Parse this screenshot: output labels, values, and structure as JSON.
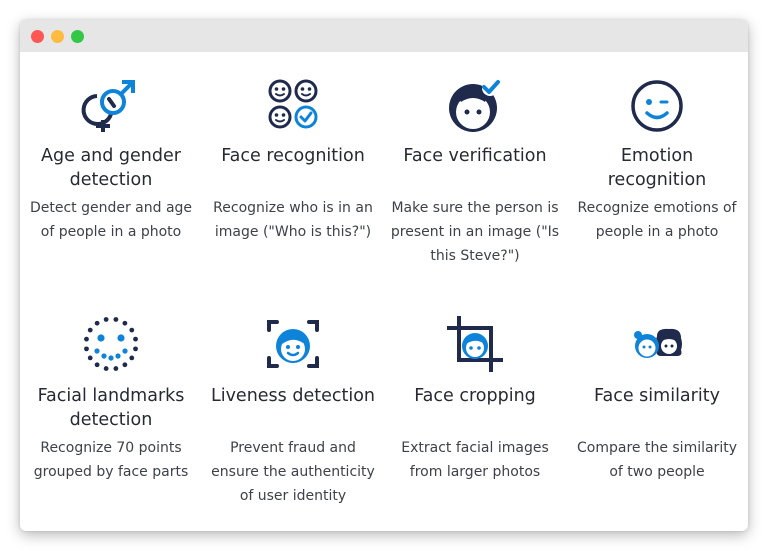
{
  "window": {
    "controls": [
      "close",
      "minimize",
      "maximize"
    ]
  },
  "colors": {
    "navy": "#1f2a4d",
    "blue": "#0d84d9"
  },
  "features": [
    {
      "icon": "gender-symbols-icon",
      "title": "Age and gender detection",
      "description": "Detect gender and age of people in a photo"
    },
    {
      "icon": "face-grid-check-icon",
      "title": "Face recognition",
      "description": "Recognize who is in an image (\"Who is this?\")"
    },
    {
      "icon": "face-checkmark-icon",
      "title": "Face verification",
      "description": "Make sure the person is present in an image (\"Is this Steve?\")"
    },
    {
      "icon": "winking-face-icon",
      "title": "Emotion recognition",
      "description": "Recognize emotions of people in a photo"
    },
    {
      "icon": "dotted-face-icon",
      "title": "Facial landmarks detection",
      "description": "Recognize 70 points grouped by face parts"
    },
    {
      "icon": "face-scan-frame-icon",
      "title": "Liveness detection",
      "description": "Prevent fraud and ensure the authenticity of user identity"
    },
    {
      "icon": "crop-face-icon",
      "title": "Face cropping",
      "description": "Extract facial images from larger photos"
    },
    {
      "icon": "two-faces-icon",
      "title": "Face similarity",
      "description": "Compare the similarity of two people"
    }
  ]
}
